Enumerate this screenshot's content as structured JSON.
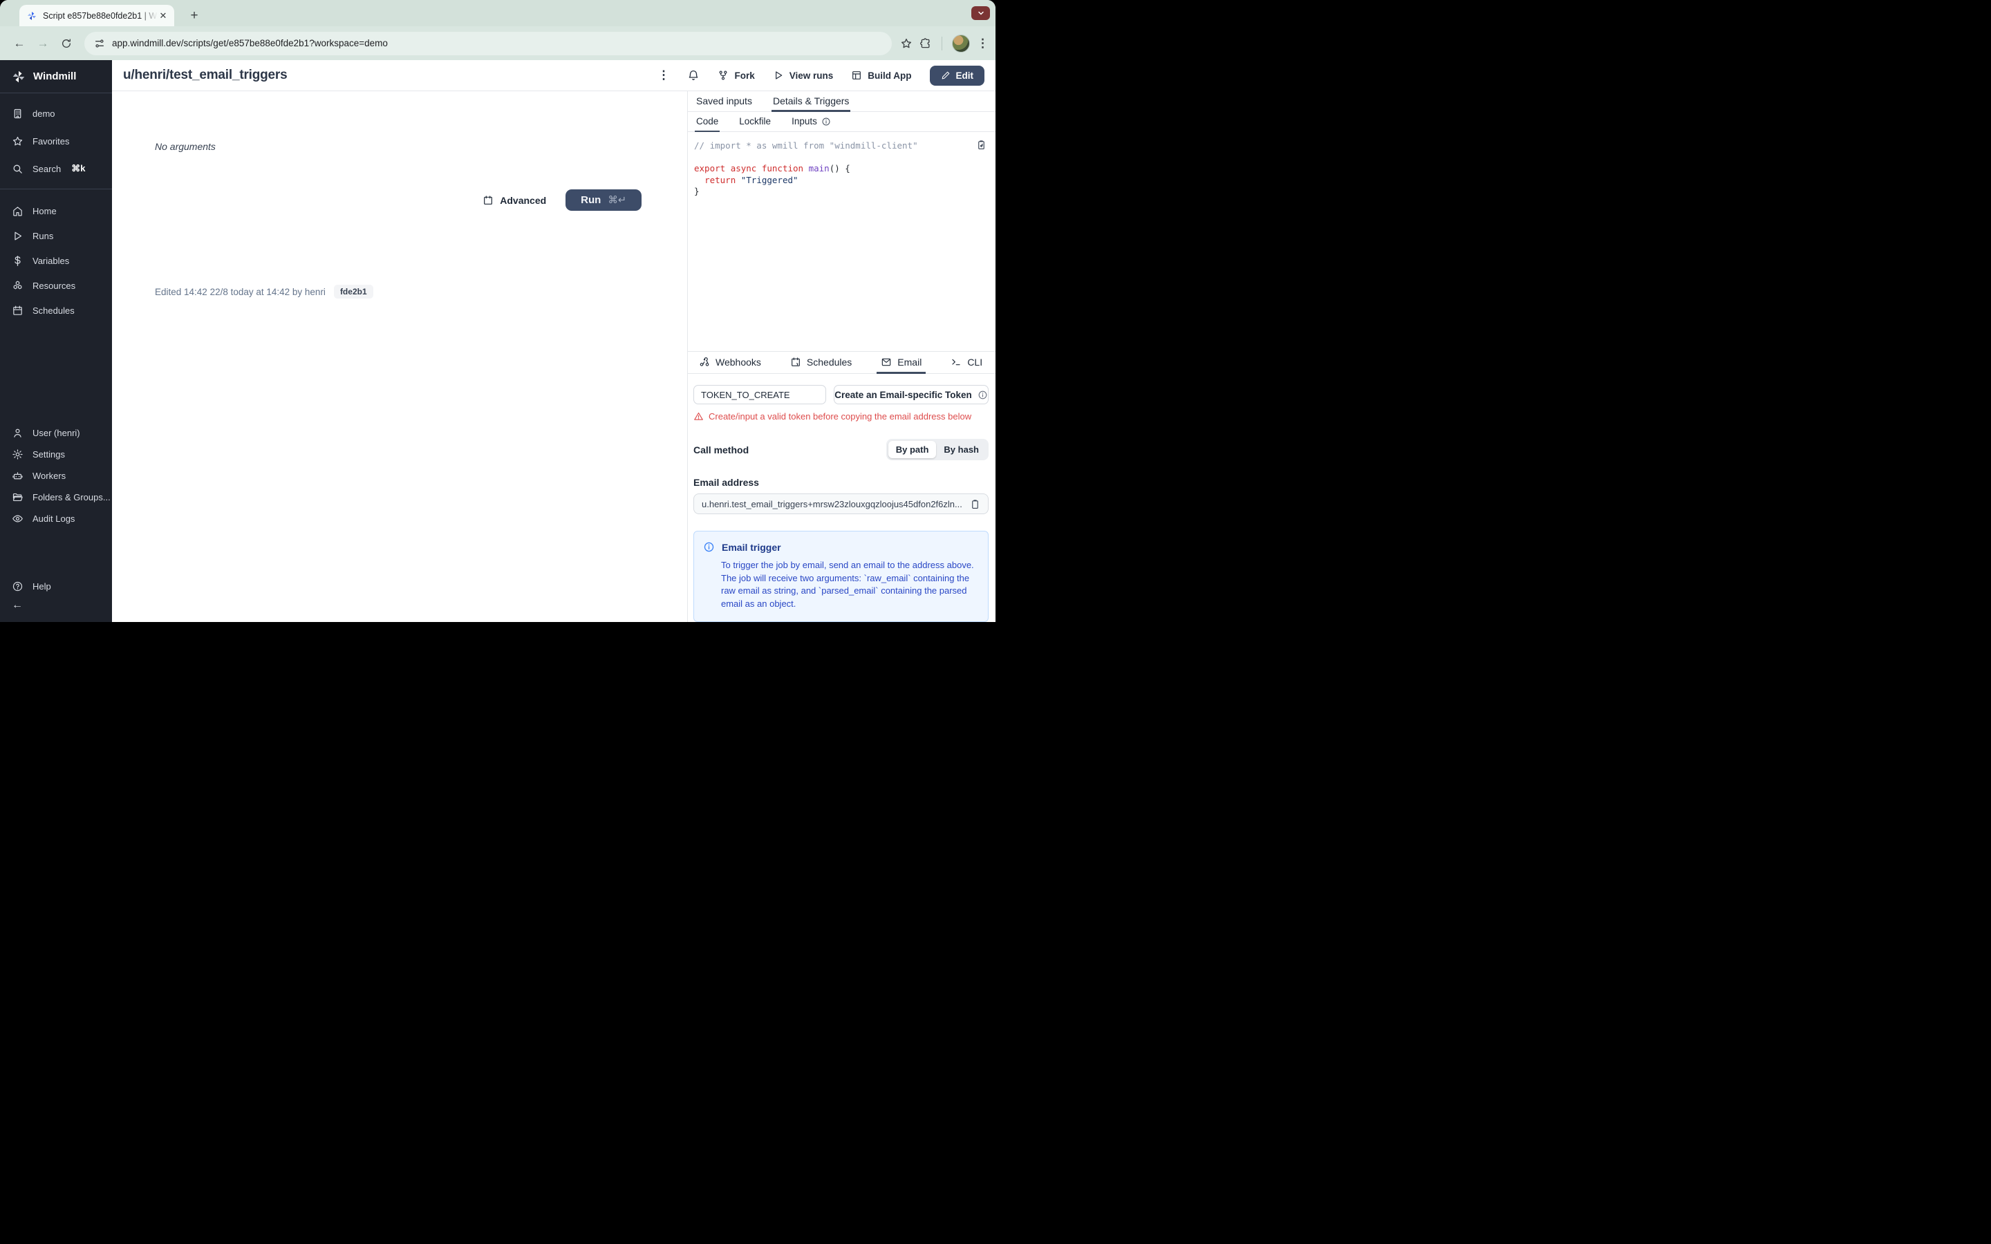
{
  "browser": {
    "tab_title": "Script e857be88e0fde2b1 | W",
    "url": "app.windmill.dev/scripts/get/e857be88e0fde2b1?workspace=demo",
    "new_tab_glyph": "+",
    "close_glyph": "✕",
    "back_glyph": "←",
    "forward_glyph": "→",
    "kebab_glyph": "⋮"
  },
  "sidebar": {
    "brand": "Windmill",
    "workspace": "demo",
    "favorites": "Favorites",
    "search": "Search",
    "search_shortcut": "⌘k",
    "nav": [
      {
        "label": "Home"
      },
      {
        "label": "Runs"
      },
      {
        "label": "Variables"
      },
      {
        "label": "Resources"
      },
      {
        "label": "Schedules"
      }
    ],
    "admin": [
      {
        "label": "User (henri)"
      },
      {
        "label": "Settings"
      },
      {
        "label": "Workers"
      },
      {
        "label": "Folders & Groups..."
      },
      {
        "label": "Audit Logs"
      }
    ],
    "help": "Help",
    "collapse_glyph": "←"
  },
  "header": {
    "title": "u/henri/test_email_triggers",
    "kebab_glyph": "⋮",
    "fork": "Fork",
    "view_runs": "View runs",
    "build_app": "Build App",
    "edit": "Edit"
  },
  "main": {
    "no_arguments": "No arguments",
    "advanced": "Advanced",
    "run": "Run",
    "run_shortcut": "⌘↵",
    "edited": "Edited 14:42 22/8 today at 14:42 by henri",
    "version_badge": "fde2b1"
  },
  "panel": {
    "tabs": [
      {
        "label": "Saved inputs"
      },
      {
        "label": "Details & Triggers"
      }
    ],
    "code_tabs": [
      {
        "label": "Code"
      },
      {
        "label": "Lockfile"
      },
      {
        "label": "Inputs"
      }
    ],
    "code_lines": [
      {
        "tokens": [
          {
            "t": "// import * as wmill from \"windmill-client\"",
            "c": "comment"
          }
        ]
      },
      {
        "tokens": []
      },
      {
        "tokens": [
          {
            "t": "export",
            "c": "kw"
          },
          {
            "t": " ",
            "c": "plain"
          },
          {
            "t": "async",
            "c": "kw"
          },
          {
            "t": " ",
            "c": "plain"
          },
          {
            "t": "function",
            "c": "kw"
          },
          {
            "t": " ",
            "c": "plain"
          },
          {
            "t": "main",
            "c": "fn"
          },
          {
            "t": "() {",
            "c": "plain"
          }
        ]
      },
      {
        "tokens": [
          {
            "t": "  ",
            "c": "plain"
          },
          {
            "t": "return",
            "c": "kw"
          },
          {
            "t": " ",
            "c": "plain"
          },
          {
            "t": "\"Triggered\"",
            "c": "str"
          }
        ]
      },
      {
        "tokens": [
          {
            "t": "}",
            "c": "plain"
          }
        ]
      }
    ],
    "trigger_tabs": [
      {
        "label": "Webhooks"
      },
      {
        "label": "Schedules"
      },
      {
        "label": "Email"
      },
      {
        "label": "CLI"
      }
    ],
    "email": {
      "token_value": "TOKEN_TO_CREATE",
      "create_button": "Create an Email-specific Token",
      "warning": "Create/input a valid token before copying the email address below",
      "call_method_label": "Call method",
      "by_path": "By path",
      "by_hash": "By hash",
      "email_label": "Email address",
      "email_value": "u.henri.test_email_triggers+mrsw23zlouxgqzloojus45dfon2f6zln...",
      "info_title": "Email trigger",
      "info_body": "To trigger the job by email, send an email to the address above. The job will receive two arguments: `raw_email` containing the raw email as string, and `parsed_email` containing the parsed email as an object."
    }
  },
  "colors": {
    "accent_dark_button": "#3d4c68",
    "sidebar_bg": "#1e222b",
    "warning_red": "#de4c4c",
    "info_bg": "#eff6ff",
    "info_border": "#bfdbfe",
    "info_text": "#2947c5",
    "chrome_bg": "#d9e6e0"
  }
}
